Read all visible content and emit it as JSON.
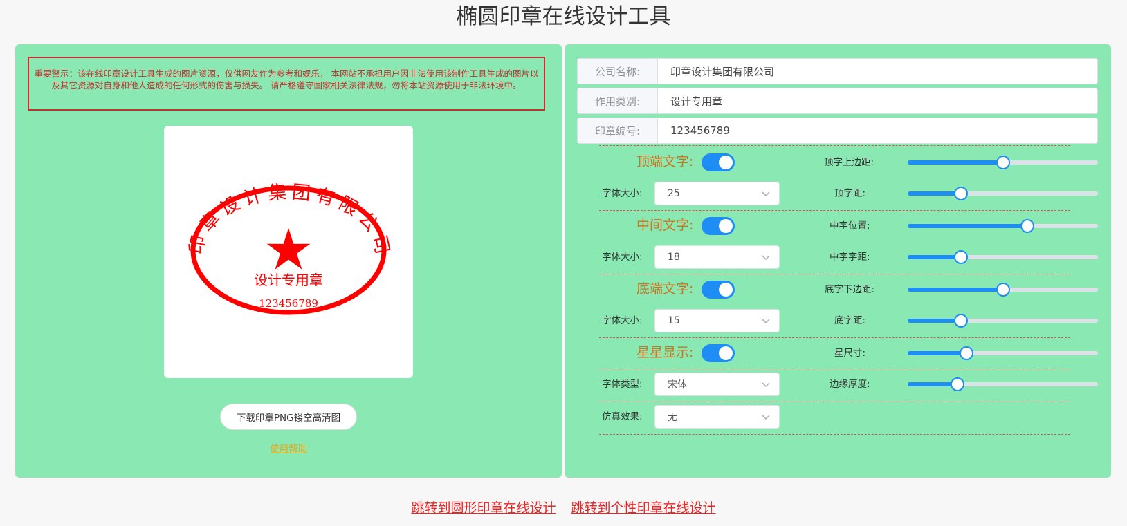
{
  "page": {
    "title": "椭圆印章在线设计工具"
  },
  "left": {
    "warning": "重要警示：该在线印章设计工具生成的图片资源，仅供网友作为参考和娱乐， 本网站不承担用户因非法使用该制作工具生成的图片以及其它资源对自身和他人造成的任何形式的伤害与损失。 请严格遵守国家相关法律法规，勿将本站资源使用于非法环境中。",
    "stamp": {
      "top_text": "印章设计集团有限公司",
      "middle_text": "设计专用章",
      "bottom_text": "123456789",
      "color": "#ff0000"
    },
    "download_label": "下载印章PNG镂空高清图",
    "help_label": "使用帮助"
  },
  "form": {
    "fields": [
      {
        "label": "公司名称:",
        "value": "印章设计集团有限公司"
      },
      {
        "label": "作用类别:",
        "value": "设计专用章"
      },
      {
        "label": "印章编号:",
        "value": "123456789"
      }
    ]
  },
  "settings": {
    "top": {
      "title": "顶端文字:",
      "enabled": true,
      "font_size_label": "字体大小:",
      "font_size": "25",
      "slider1_label": "顶字上边距:",
      "slider1_value": 0.5,
      "slider2_label": "顶字距:",
      "slider2_value": 0.28
    },
    "middle": {
      "title": "中间文字:",
      "enabled": true,
      "font_size_label": "字体大小:",
      "font_size": "18",
      "slider1_label": "中字位置:",
      "slider1_value": 0.63,
      "slider2_label": "中字字距:",
      "slider2_value": 0.28
    },
    "bottom": {
      "title": "底端文字:",
      "enabled": true,
      "font_size_label": "字体大小:",
      "font_size": "15",
      "slider1_label": "底字下边距:",
      "slider1_value": 0.5,
      "slider2_label": "底字距:",
      "slider2_value": 0.28
    },
    "star": {
      "title": "星星显示:",
      "enabled": true,
      "slider1_label": "星尺寸:",
      "slider1_value": 0.31
    },
    "font_type_label": "字体类型:",
    "font_type": "宋体",
    "border_label": "边缘厚度:",
    "border_value": 0.26,
    "effect_label": "仿真效果:",
    "effect": "无"
  },
  "links": {
    "round": "跳转到圆形印章在线设计",
    "personal": "跳转到个性印章在线设计"
  },
  "colors": {
    "panel": "#8ae8b3",
    "accent": "#1e8ef5",
    "warning": "#c62f2f",
    "section_title": "#c9751f"
  }
}
